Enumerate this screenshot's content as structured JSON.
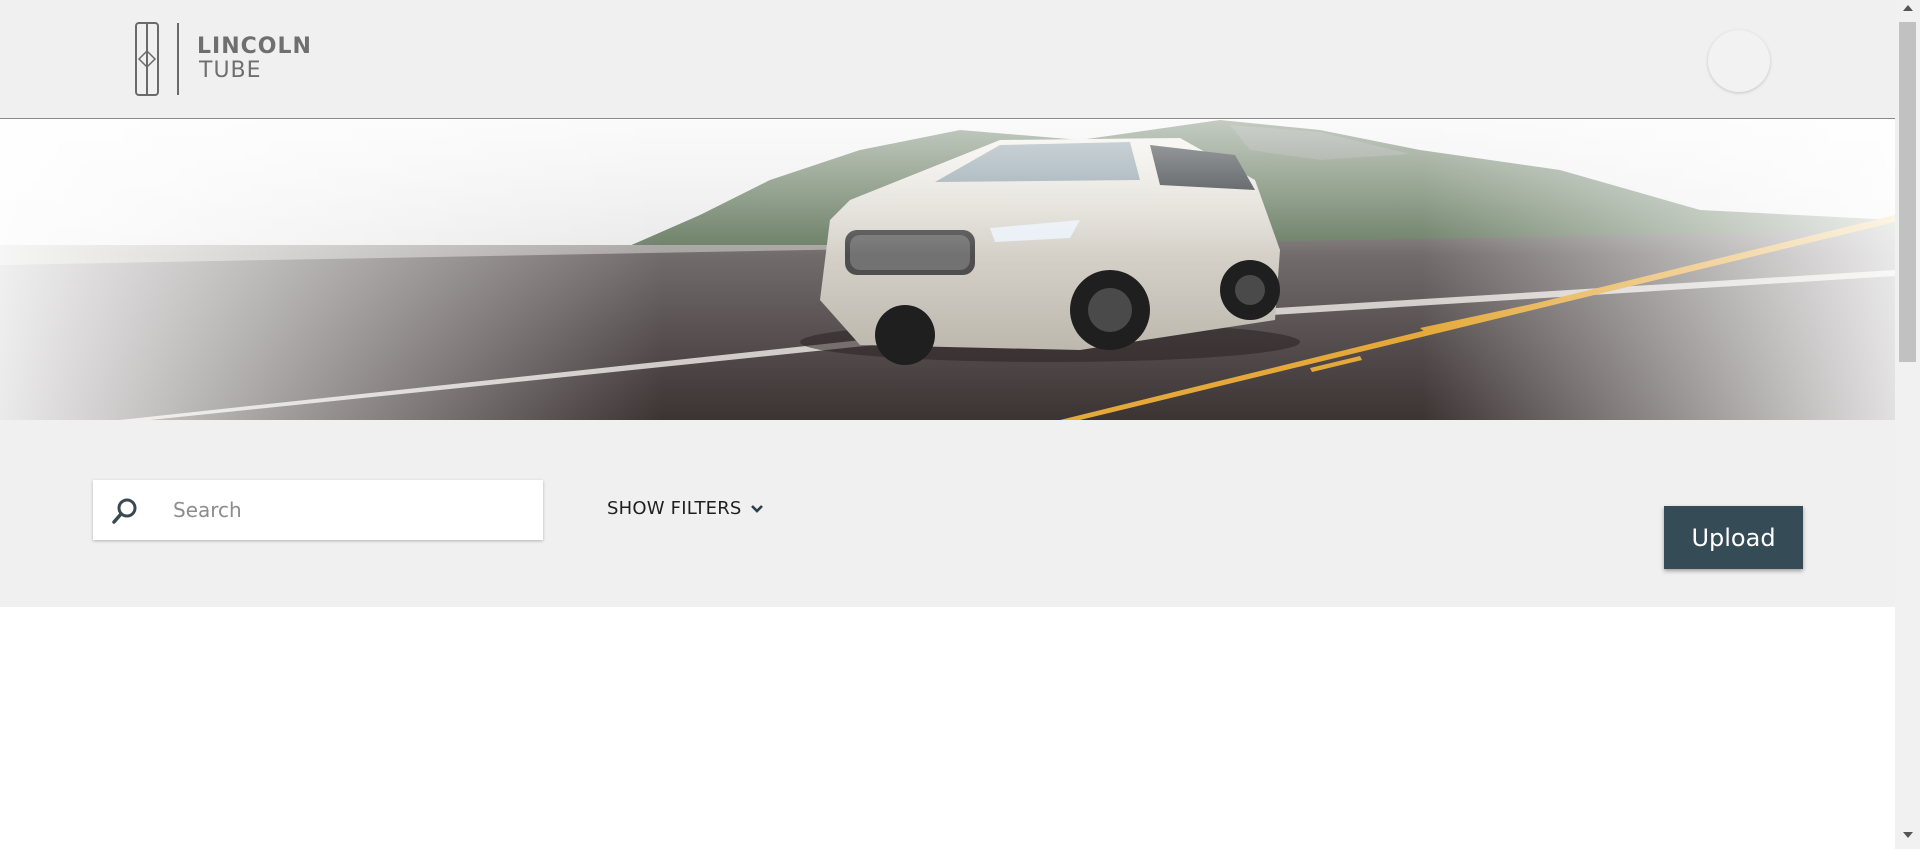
{
  "header": {
    "logo": {
      "line1": "LINCOLN",
      "line2": "TUBE"
    },
    "avatar_icon": "user-avatar"
  },
  "hero": {
    "image": "white Lincoln SUV driving on a coastal mountain road"
  },
  "toolbar": {
    "search": {
      "placeholder": "Search",
      "value": "",
      "icon": "search-icon"
    },
    "filters_label": "SHOW FILTERS",
    "filters_icon": "chevron-down-icon",
    "upload_label": "Upload"
  },
  "colors": {
    "header_bg": "#f0f0f0",
    "toolbar_bg": "#f0f0f0",
    "upload_bg": "#354b55",
    "text_dark": "#1f1f1f",
    "logo_gray": "#6f6f6f"
  }
}
